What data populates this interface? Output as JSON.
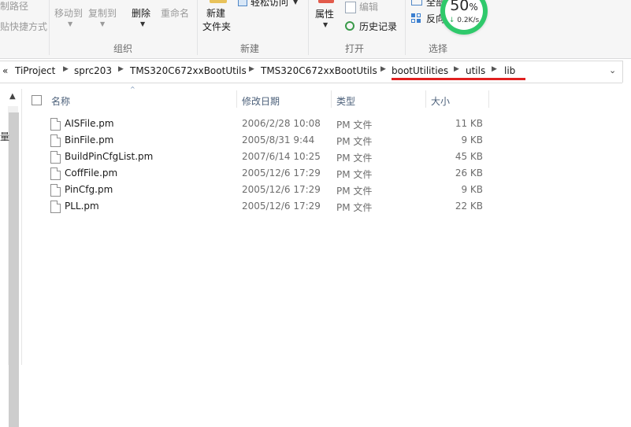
{
  "ribbon": {
    "partial_top_left": "制路径",
    "partial_shortcut": "贴快捷方式",
    "move_to": "移动到",
    "copy_to": "复制到",
    "delete": "删除",
    "rename": "重命名",
    "new_folder_line1": "新建",
    "new_folder_line2": "文件夹",
    "easy_access": "轻松访问",
    "properties": "属性",
    "edit": "编辑",
    "history": "历史记录",
    "select_all_partial": "全部",
    "invert_partial": "反向",
    "groups": {
      "organize": "组织",
      "new": "新建",
      "open": "打开",
      "select": "选择"
    }
  },
  "perf": {
    "percent": "50",
    "percent_sign": "%",
    "speed_arrow": "↓",
    "speed": "0.2K/s"
  },
  "address": {
    "overflow": "«",
    "crumbs": [
      "TiProject",
      "sprc203",
      "TMS320C672xxBootUtils",
      "TMS320C672xxBootUtils",
      "bootUtilities",
      "utils",
      "lib"
    ]
  },
  "nav": {
    "partial_label": "量"
  },
  "columns": {
    "name": "名称",
    "date": "修改日期",
    "type": "类型",
    "size": "大小"
  },
  "files": [
    {
      "name": "AISFile.pm",
      "date": "2006/2/28 10:08",
      "type": "PM 文件",
      "size": "11 KB"
    },
    {
      "name": "BinFile.pm",
      "date": "2005/8/31 9:44",
      "type": "PM 文件",
      "size": "9 KB"
    },
    {
      "name": "BuildPinCfgList.pm",
      "date": "2007/6/14 10:25",
      "type": "PM 文件",
      "size": "45 KB"
    },
    {
      "name": "CoffFile.pm",
      "date": "2005/12/6 17:29",
      "type": "PM 文件",
      "size": "26 KB"
    },
    {
      "name": "PinCfg.pm",
      "date": "2005/12/6 17:29",
      "type": "PM 文件",
      "size": "9 KB"
    },
    {
      "name": "PLL.pm",
      "date": "2005/12/6 17:29",
      "type": "PM 文件",
      "size": "22 KB"
    }
  ]
}
